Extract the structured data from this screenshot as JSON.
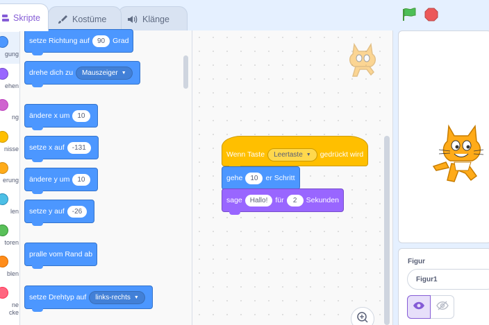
{
  "tabs": [
    {
      "label": "Skripte",
      "icon": "code-icon"
    },
    {
      "label": "Kostüme",
      "icon": "brush-icon"
    },
    {
      "label": "Klänge",
      "icon": "speaker-icon"
    }
  ],
  "controls": {
    "green_flag": "green-flag-icon",
    "stop": "stop-icon"
  },
  "categories": [
    {
      "label": "gung",
      "color": "#4c97ff"
    },
    {
      "label": "ehen",
      "color": "#9966ff"
    },
    {
      "label": "ng",
      "color": "#cf63cf"
    },
    {
      "label": "nisse",
      "color": "#ffbf00"
    },
    {
      "label": "erung",
      "color": "#ffab19"
    },
    {
      "label": "len",
      "color": "#4cbfe6"
    },
    {
      "label": "toren",
      "color": "#59c059"
    },
    {
      "label": "blen",
      "color": "#ff8c1a"
    },
    {
      "label": "ne\ncke",
      "color": "#ff6680"
    }
  ],
  "palette": {
    "b1": {
      "pre": "setze Richtung auf",
      "value": "90",
      "post": "Grad"
    },
    "b2": {
      "pre": "drehe dich zu",
      "dropdown": "Mauszeiger"
    },
    "b3": {
      "pre": "ändere x um",
      "value": "10"
    },
    "b4": {
      "pre": "setze x auf",
      "value": "-131"
    },
    "b5": {
      "pre": "ändere y um",
      "value": "10"
    },
    "b6": {
      "pre": "setze y auf",
      "value": "-26"
    },
    "b7": {
      "pre": "pralle vom Rand ab"
    },
    "b8": {
      "pre": "setze Drehtyp auf",
      "dropdown": "links-rechts"
    }
  },
  "script": {
    "hat": {
      "pre": "Wenn Taste",
      "dropdown": "Leertaste",
      "post": "gedrückt wird"
    },
    "move": {
      "pre": "gehe",
      "value": "10",
      "post": "er Schritt"
    },
    "say": {
      "pre": "sage",
      "text": "Hallo!",
      "mid": "für",
      "secs": "2",
      "post": "Sekunden"
    }
  },
  "sprite_info": {
    "label": "Figur",
    "name": "Figur1"
  },
  "colors": {
    "motion": "#4c97ff",
    "events": "#ffbf00",
    "looks": "#9966ff",
    "accent": "#855cd6"
  }
}
